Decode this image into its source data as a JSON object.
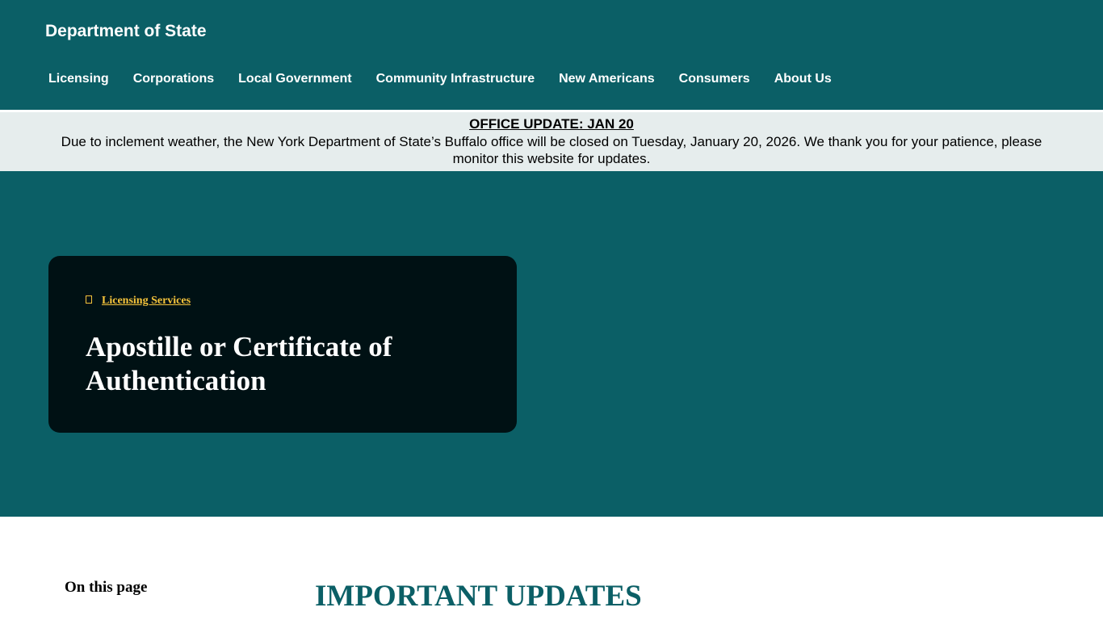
{
  "header": {
    "site_title": "Department of State",
    "nav": [
      {
        "label": "Licensing"
      },
      {
        "label": "Corporations"
      },
      {
        "label": "Local Government"
      },
      {
        "label": "Community Infrastructure"
      },
      {
        "label": "New Americans"
      },
      {
        "label": "Consumers"
      },
      {
        "label": "About Us"
      }
    ]
  },
  "alert": {
    "title": "OFFICE UPDATE: JAN 20",
    "body": "Due to inclement weather, the New York Department of State’s Buffalo office will be closed on Tuesday, January 20, 2026. We thank you for your patience, please monitor this website for updates."
  },
  "hero": {
    "breadcrumb_icon": "page-icon",
    "breadcrumb_label": "Licensing Services",
    "title": "Apostille or Certificate of Authentication"
  },
  "content": {
    "toc_label": "On this page",
    "section_heading": "IMPORTANT UPDATES"
  },
  "colors": {
    "brand_teal": "#0b5f66",
    "card_dark": "#001114",
    "accent_gold": "#f5c33b",
    "alert_bg": "#e6eded"
  }
}
